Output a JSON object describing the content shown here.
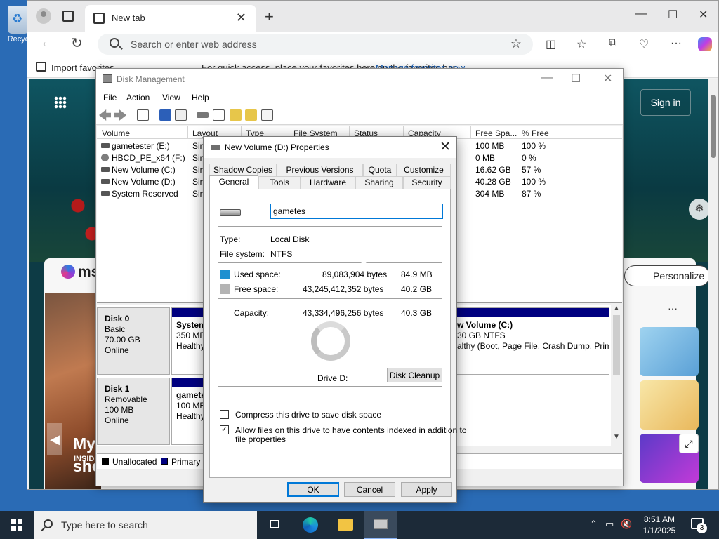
{
  "desktop": {
    "recycle_label": "Recyc"
  },
  "browser": {
    "tab_title": "New tab",
    "new_tab_glyph": "+",
    "close_glyph": "✕",
    "minimize_glyph": "—",
    "maximize_glyph": "☐",
    "address_placeholder": "Search or enter web address",
    "favbar": {
      "import": "Import favorites",
      "hint": "For quick access, place your favorites here on the favorites bar.",
      "manage": "Manage favorites now"
    },
    "page": {
      "sign_in": "Sign in",
      "msn": "msn",
      "personalize": "Personalize",
      "news_tag": "INSIDE",
      "news_title_1": "My h",
      "news_title_2": "shop",
      "more": "···"
    }
  },
  "disk_management": {
    "title": "Disk Management",
    "menu": [
      "File",
      "Action",
      "View",
      "Help"
    ],
    "columns": [
      "Volume",
      "Layout",
      "Type",
      "File System",
      "Status",
      "Capacity",
      "Free Spa...",
      "% Free"
    ],
    "volumes": [
      {
        "name": "gametester (E:)",
        "layout": "Sim",
        "free": "100 MB",
        "pct": "100 %"
      },
      {
        "name": "HBCD_PE_x64 (F:)",
        "layout": "Sim",
        "free": "0 MB",
        "pct": "0 %"
      },
      {
        "name": "New Volume (C:)",
        "layout": "Sim",
        "free": "16.62 GB",
        "pct": "57 %"
      },
      {
        "name": "New Volume (D:)",
        "layout": "Sim",
        "free": "40.28 GB",
        "pct": "100 %"
      },
      {
        "name": "System Reserved",
        "layout": "Sim",
        "free": "304 MB",
        "pct": "87 %"
      }
    ],
    "disks": [
      {
        "name": "Disk 0",
        "type": "Basic",
        "size": "70.00 GB",
        "status": "Online"
      },
      {
        "name": "Disk 1",
        "type": "Removable",
        "size": "100 MB",
        "status": "Online"
      }
    ],
    "partitions": {
      "sys_name": "System",
      "sys_size": "350 MB",
      "sys_status": "Healthy",
      "c_name": "w Volume  (C:)",
      "c_size": "30 GB NTFS",
      "c_status": "althy (Boot, Page File, Crash Dump, Prim",
      "game_name": "gamete",
      "game_size": "100 MB",
      "game_status": "Healthy"
    },
    "legend": {
      "unallocated": "Unallocated",
      "primary": "Primary p"
    }
  },
  "properties": {
    "title": "New Volume (D:) Properties",
    "tabs_row1": [
      "Shadow Copies",
      "Previous Versions",
      "Quota",
      "Customize"
    ],
    "tabs_row2": [
      "General",
      "Tools",
      "Hardware",
      "Sharing",
      "Security"
    ],
    "volume_label_value": "gametes",
    "type_label": "Type:",
    "type_value": "Local Disk",
    "fs_label": "File system:",
    "fs_value": "NTFS",
    "used_label": "Used space:",
    "used_bytes": "89,083,904 bytes",
    "used_size": "84.9 MB",
    "free_label": "Free space:",
    "free_bytes": "43,245,412,352 bytes",
    "free_size": "40.2 GB",
    "capacity_label": "Capacity:",
    "capacity_bytes": "43,334,496,256 bytes",
    "capacity_size": "40.3 GB",
    "drive_label": "Drive D:",
    "disk_cleanup": "Disk Cleanup",
    "compress_label": "Compress this drive to save disk space",
    "compress_checked": false,
    "index_label_1": "Allow files on this drive to have contents indexed in addition to",
    "index_label_2": "file properties",
    "index_checked": true,
    "check_glyph": "✓",
    "ok": "OK",
    "cancel": "Cancel",
    "apply": "Apply",
    "colors": {
      "used": "#1e90d0",
      "free": "#b4b4b4",
      "accent": "#0078d7"
    }
  },
  "taskbar": {
    "search_placeholder": "Type here to search",
    "time": "8:51 AM",
    "date": "1/1/2025",
    "notifications": "3"
  }
}
